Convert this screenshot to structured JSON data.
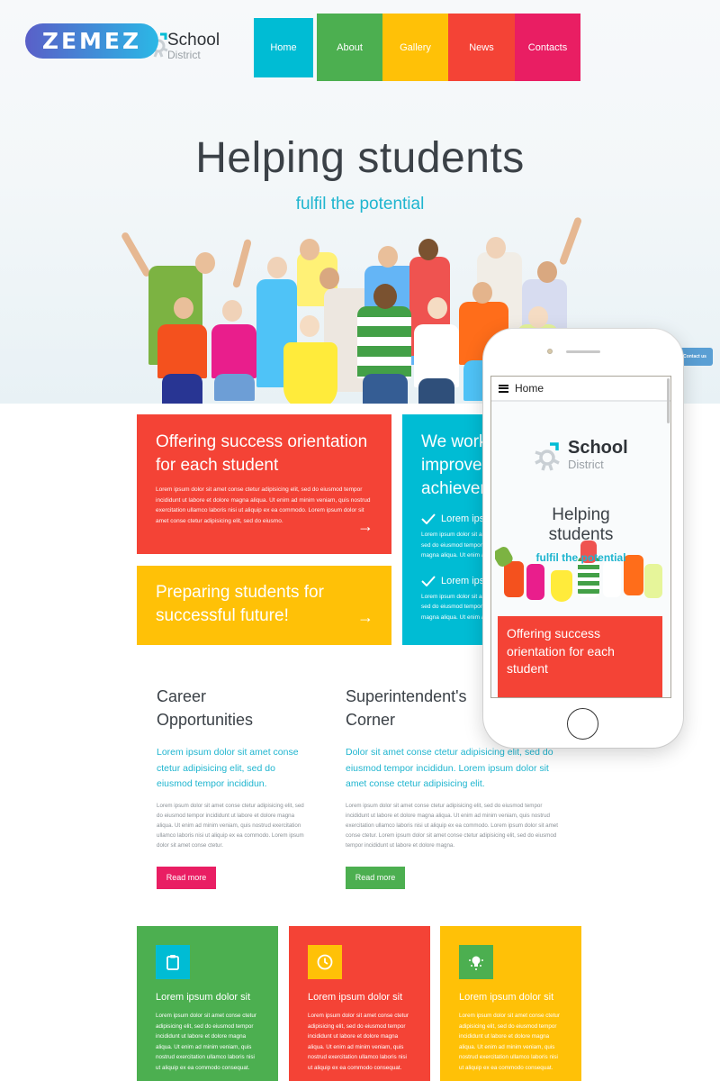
{
  "brand": {
    "badge": "ZEMEZ",
    "logo_title": "School",
    "logo_subtitle": "District"
  },
  "nav": [
    {
      "label": "Home",
      "color": "#00bcd4",
      "active": true
    },
    {
      "label": "About",
      "color": "#4caf50"
    },
    {
      "label": "Gallery",
      "color": "#ffc107"
    },
    {
      "label": "News",
      "color": "#f44336"
    },
    {
      "label": "Contacts",
      "color": "#e91e63"
    }
  ],
  "hero": {
    "title": "Helping students",
    "subtitle": "fulfil the potential",
    "image_alt": "group of happy jumping children and adults"
  },
  "cards": {
    "orientation": {
      "title": "Offering success orientation for each student",
      "text": "Lorem ipsum dolor sit amet conse ctetur adipisicing elit, sed do eiusmod tempor incididunt ut labore et dolore magna aliqua. Ut enim ad minim veniam, quis nostrud exercitation ullamco laboris nisi ut aliquip ex ea commodo. Lorem ipsum dolor sit amet conse ctetur adipisicing elit, sed do eiusmo.",
      "arrow_icon": "arrow-right-icon"
    },
    "future": {
      "title": "Preparing students for successful future!",
      "arrow_icon": "arrow-right-icon"
    },
    "achievement": {
      "title": "We work to improve achievement",
      "items": [
        {
          "title": "Lorem ipsum",
          "text_lines": [
            "Lorem ipsum dolor sit amet conse",
            "sed do eiusmod tempor incididunt",
            "magna aliqua. Ut enim ad minim"
          ]
        },
        {
          "title": "Lorem ipsum",
          "text_lines": [
            "Lorem ipsum dolor sit amet conse",
            "sed do eiusmod tempor incididunt",
            "magna aliqua. Ut enim ad minim"
          ]
        }
      ]
    }
  },
  "columns": {
    "career": {
      "title": "Career Opportunities",
      "lead": "Lorem ipsum dolor sit amet conse ctetur adipisicing elit, sed do eiusmod tempor incididun.",
      "text": "Lorem ipsum dolor sit amet conse ctetur adipisicing elit, sed do eiusmod tempor incididunt ut labore et dolore magna aliqua. Ut enim ad minim veniam, quis nostrud exercitation ullamco laboris nisi ut aliquip ex ea commodo. Lorem ipsum dolor sit amet conse ctetur.",
      "button": "Read more"
    },
    "superintendent": {
      "title": "Superintendent's Corner",
      "lead": "Dolor sit amet conse ctetur adipisicing elit, sed do eiusmod tempor incididun. Lorem ipsum dolor sit amet conse ctetur adipisicing elit.",
      "text": "Lorem ipsum dolor sit amet conse ctetur adipisicing elit, sed do eiusmod tempor incididunt ut labore et dolore magna aliqua. Ut enim ad minim veniam, quis nostrud exercitation ullamco laboris nisi ut aliquip ex ea commodo. Lorem ipsum dolor sit amet conse ctetur. Lorem ipsum dolor sit amet conse ctetur adipisicing elit, sed do eiusmod tempor incididunt ut labore et dolore magna.",
      "button": "Read more"
    }
  },
  "tiles": [
    {
      "icon": "clipboard-icon",
      "title": "Lorem ipsum dolor sit",
      "text": "Lorem ipsum dolor sit amet conse ctetur adipisicing elit, sed do eiusmod tempor incididunt ut labore et dolore magna aliqua. Ut enim ad minim veniam, quis nostrud exercitation ullamco laboris nisi ut aliquip ex ea commodo consequat."
    },
    {
      "icon": "clock-icon",
      "title": "Lorem ipsum dolor sit",
      "text": "Lorem ipsum dolor sit amet conse ctetur adipisicing elit, sed do eiusmod tempor incididunt ut labore et dolore magna aliqua. Ut enim ad minim veniam, quis nostrud exercitation ullamco laboris nisi ut aliquip ex ea commodo consequat."
    },
    {
      "icon": "lightbulb-icon",
      "title": "Lorem ipsum dolor sit",
      "text": "Lorem ipsum dolor sit amet conse ctetur adipisicing elit, sed do eiusmod tempor incididunt ut labore et dolore magna aliqua. Ut enim ad minim veniam, quis nostrud exercitation ullamco laboris nisi ut aliquip ex ea commodo consequat."
    }
  ],
  "phone": {
    "menu_label": "Home",
    "logo_title": "School",
    "logo_subtitle": "District",
    "hero_title": "Helping students",
    "hero_subtitle": "fulfil the potential",
    "card_title": "Offering success orientation for each student"
  },
  "contact_tab": "Contact us",
  "colors": {
    "cyan": "#00bcd4",
    "green": "#4caf50",
    "yellow": "#ffc107",
    "red": "#f44336",
    "pink": "#e91e63",
    "accent_text": "#1fb5cf"
  }
}
